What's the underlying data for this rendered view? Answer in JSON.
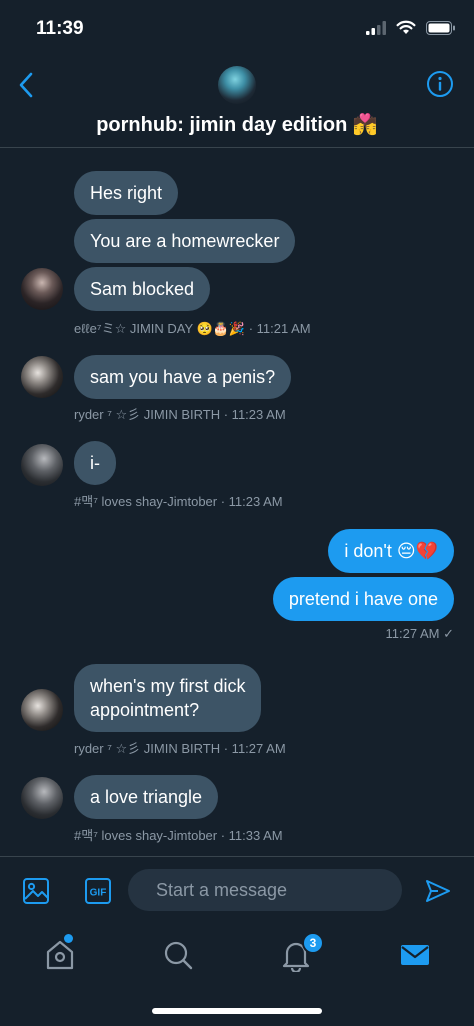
{
  "status_bar": {
    "time": "11:39"
  },
  "header": {
    "title": "pornhub: jimin day edition 💏"
  },
  "messages": [
    {
      "text": "Hes right"
    },
    {
      "text": "You are a homewrecker"
    },
    {
      "text": "Sam blocked"
    },
    {
      "meta": "eℓℓe⁷ミ☆ JIMIN DAY 🥺🎂🎉 · 11:21 AM"
    },
    {
      "text": "sam you have a penis?"
    },
    {
      "meta": "ryder ⁷ ☆彡 JIMIN BIRTH · 11:23 AM"
    },
    {
      "text": "i-"
    },
    {
      "meta": "#맥⁷ loves shay-Jimtober · 11:23 AM"
    },
    {
      "text": "i don't 😔💔"
    },
    {
      "text": "pretend i have one"
    },
    {
      "meta": "11:27 AM ✓"
    },
    {
      "text": "when's my first dick\nappointment?"
    },
    {
      "meta": "ryder ⁷ ☆彡 JIMIN BIRTH · 11:27 AM"
    },
    {
      "text": "a love triangle"
    },
    {
      "meta": "#맥⁷ loves shay-Jimtober · 11:33 AM"
    }
  ],
  "composer": {
    "placeholder": "Start a message"
  },
  "tabbar": {
    "notifications_count": "3"
  },
  "colors": {
    "background": "#15202b",
    "accent": "#1d9bf0",
    "incoming_bubble": "#3d5466"
  }
}
